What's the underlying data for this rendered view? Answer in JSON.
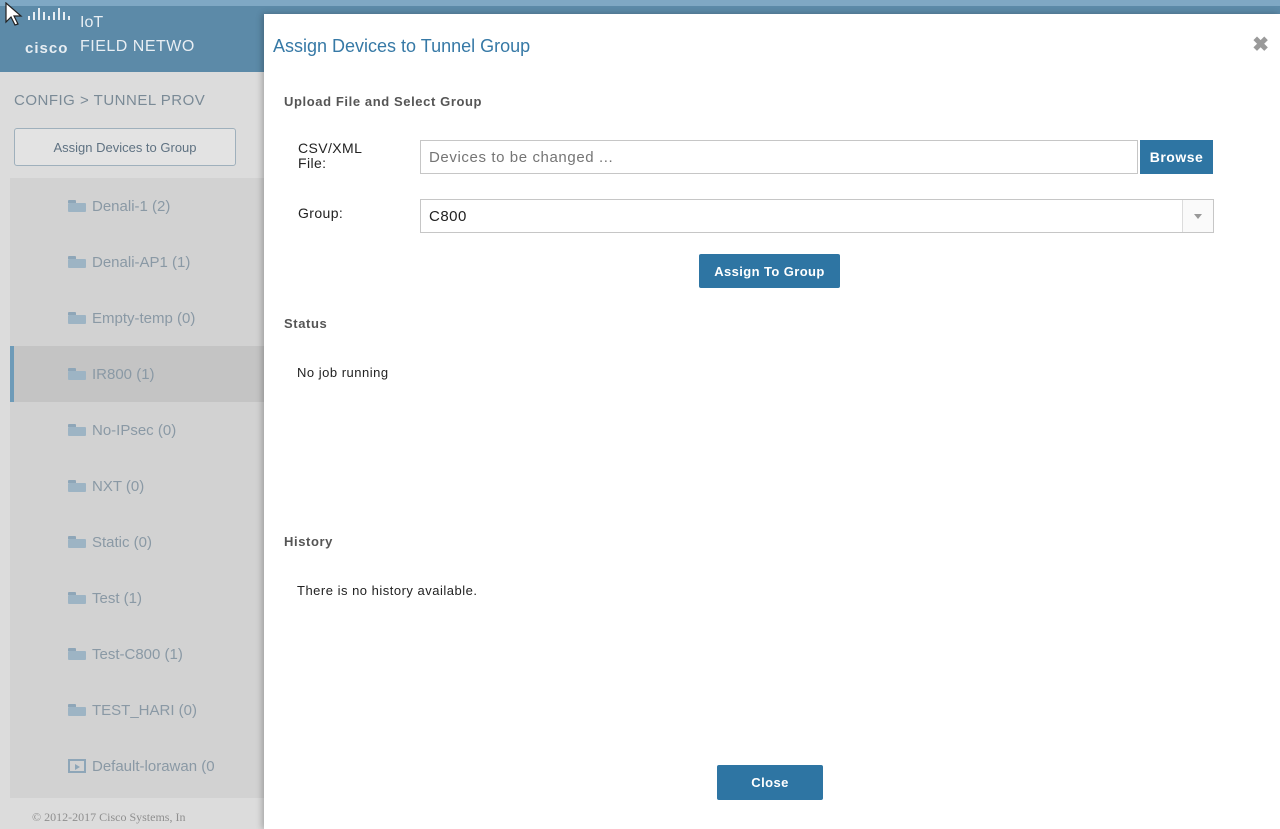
{
  "app": {
    "brand": "cisco",
    "product_line1": "IoT",
    "product_line2": "FIELD NETWO"
  },
  "left": {
    "breadcrumb": "CONFIG > TUNNEL PROV",
    "assign_button": "Assign Devices to Group",
    "groups": [
      {
        "label": "Denali-1 (2)",
        "icon": "folder-icon",
        "selected": false
      },
      {
        "label": "Denali-AP1 (1)",
        "icon": "folder-icon",
        "selected": false
      },
      {
        "label": "Empty-temp (0)",
        "icon": "folder-icon",
        "selected": false
      },
      {
        "label": "IR800 (1)",
        "icon": "folder-icon",
        "selected": true
      },
      {
        "label": "No-IPsec (0)",
        "icon": "folder-icon",
        "selected": false
      },
      {
        "label": "NXT (0)",
        "icon": "folder-icon",
        "selected": false
      },
      {
        "label": "Static (0)",
        "icon": "folder-icon",
        "selected": false
      },
      {
        "label": "Test (1)",
        "icon": "folder-icon",
        "selected": false
      },
      {
        "label": "Test-C800 (1)",
        "icon": "folder-icon",
        "selected": false
      },
      {
        "label": "TEST_HARI (0)",
        "icon": "folder-icon",
        "selected": false
      },
      {
        "label": "Default-lorawan (0",
        "icon": "default-group-icon",
        "selected": false
      }
    ],
    "copyright": "© 2012-2017 Cisco Systems, In"
  },
  "modal": {
    "title": "Assign Devices to Tunnel Group",
    "close_symbol": "✖",
    "upload_section": "Upload File and Select Group",
    "file_label": "CSV/XML File:",
    "file_placeholder": "Devices to be changed ...",
    "browse_label": "Browse",
    "group_label": "Group:",
    "group_value": "C800",
    "assign_label": "Assign To Group",
    "status_title": "Status",
    "status_text": "No job running",
    "history_title": "History",
    "history_text": "There is no history available.",
    "close_label": "Close"
  },
  "colors": {
    "accent": "#2e75a3",
    "title": "#3679a6",
    "topbar": "#5c8aa8"
  }
}
